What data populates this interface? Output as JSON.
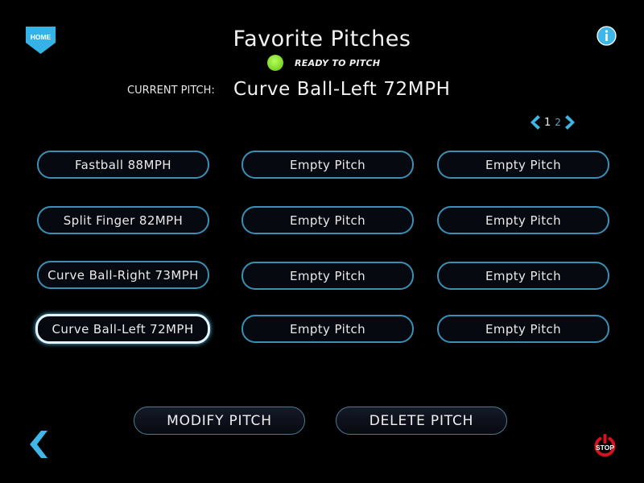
{
  "header": {
    "home_label": "HOME",
    "title": "Favorite Pitches",
    "status_text": "READY TO PITCH",
    "status_color": "#8fe33a",
    "info_icon": "info-icon"
  },
  "current_pitch": {
    "label": "CURRENT PITCH:",
    "value": "Curve Ball-Left 72MPH"
  },
  "pagination": {
    "pages": [
      "1",
      "2"
    ],
    "current_page": "1"
  },
  "pitches": [
    {
      "label": "Fastball 88MPH",
      "selected": false
    },
    {
      "label": "Empty Pitch",
      "selected": false
    },
    {
      "label": "Empty Pitch",
      "selected": false
    },
    {
      "label": "Split Finger 82MPH",
      "selected": false
    },
    {
      "label": "Empty Pitch",
      "selected": false
    },
    {
      "label": "Empty Pitch",
      "selected": false
    },
    {
      "label": "Curve Ball-Right 73MPH",
      "selected": false
    },
    {
      "label": "Empty Pitch",
      "selected": false
    },
    {
      "label": "Empty Pitch",
      "selected": false
    },
    {
      "label": "Curve Ball-Left 72MPH",
      "selected": true
    },
    {
      "label": "Empty Pitch",
      "selected": false
    },
    {
      "label": "Empty Pitch",
      "selected": false
    }
  ],
  "actions": {
    "modify_label": "MODIFY PITCH",
    "delete_label": "DELETE PITCH"
  },
  "footer": {
    "stop_label": "STOP"
  },
  "colors": {
    "accent": "#3fb6e8",
    "button_border": "#3c8fb4",
    "stop_red": "#d6131b"
  }
}
